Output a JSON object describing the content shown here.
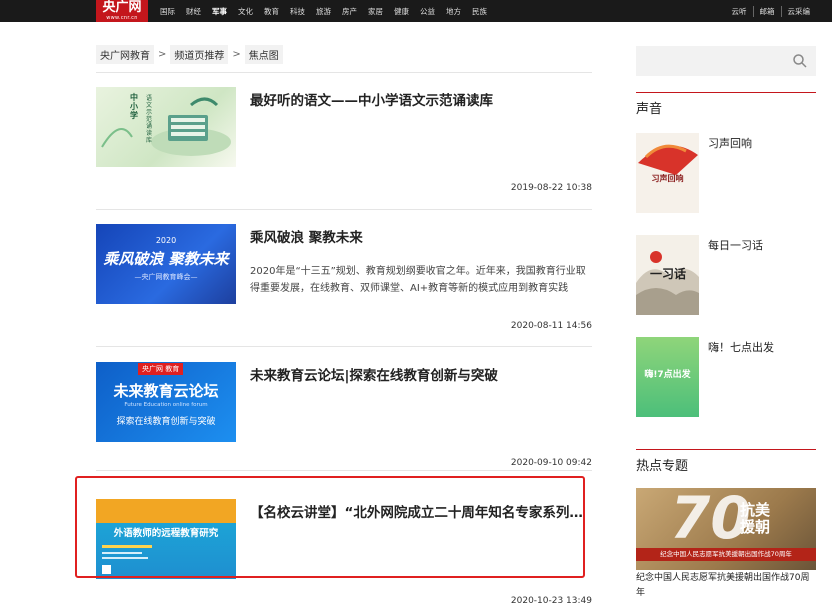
{
  "site": {
    "logo_text": "央广网",
    "logo_sub": "www.cnr.cn"
  },
  "nav": {
    "items": [
      "国际",
      "财经",
      "军事",
      "文化",
      "教育",
      "科技",
      "旅游",
      "房产",
      "家居",
      "健康",
      "公益",
      "地方",
      "民族"
    ],
    "active": "军事"
  },
  "top_links": [
    "云听",
    "邮箱",
    "云采编"
  ],
  "breadcrumb": [
    "央广网教育",
    "频道页推荐",
    "焦点图"
  ],
  "articles": [
    {
      "title": "最好听的语文——中小学语文示范诵读库",
      "summary": "",
      "date": "2019-08-22 10:38",
      "thumb_text": [
        "中小学",
        "语文示范诵读库"
      ]
    },
    {
      "title": "乘风破浪 聚教未来",
      "summary": "2020年是“十三五”规划、教育规划纲要收官之年。近年来，我国教育行业取得重要发展，在线教育、双师课堂、AI+教育等新的模式应用到教育实践",
      "date": "2020-08-11 14:56",
      "thumb_text": [
        "2020",
        "乘风破浪 聚教未来",
        "—央广网教育峰会—"
      ]
    },
    {
      "title": "未来教育云论坛|探索在线教育创新与突破",
      "summary": "",
      "date": "2020-09-10 09:42",
      "thumb_text": [
        "央广网 教育",
        "未来教育云论坛",
        "Future Education online forum",
        "探索在线教育创新与突破"
      ]
    },
    {
      "title": "【名校云讲堂】“北外网院成立二十周年知名专家系列讲座”",
      "summary": "",
      "date": "2020-10-23 13:49",
      "thumb_text": [
        "外语教师的远程教育研究"
      ]
    }
  ],
  "sidebar": {
    "search_placeholder": "",
    "voice_heading": "声音",
    "voice_items": [
      {
        "title": "习声回响",
        "thumb_text": "习声回响"
      },
      {
        "title": "每日一习话",
        "thumb_text": "一习话"
      },
      {
        "title": "嗨！七点出发",
        "thumb_text": "嗨!7点出发"
      }
    ],
    "topic_heading": "热点专题",
    "topic": {
      "caption": "纪念中国人民志愿军抗美援朝出国作战70周年",
      "thumb_big": "70",
      "thumb_text": "抗美援朝",
      "thumb_band": "纪念中国人民志愿军抗美援朝出国作战70周年"
    }
  },
  "colors": {
    "brand_red": "#c4161c",
    "highlight_red": "#e02020",
    "topbar": "#1a1a1a"
  }
}
